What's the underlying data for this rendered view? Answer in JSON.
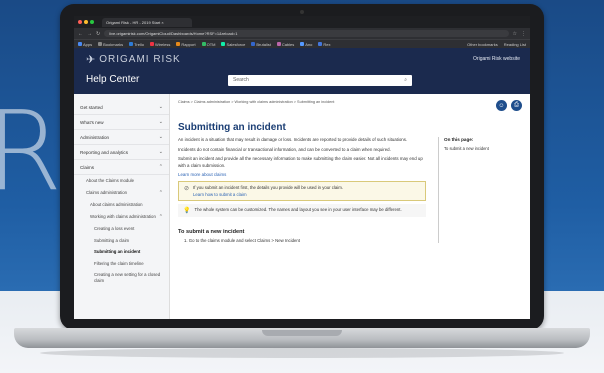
{
  "background": {
    "letter": "R",
    "brand_color": "#1f5ea4"
  },
  "browser": {
    "tab_title": "Origami Risk - HR - 2019 Start  ×",
    "url": "live.origamirisk.com/OrigamiCloud/Dashboards/Home?RSF=1&reload=1",
    "bookmarks": [
      "Apps",
      "Bookmarks",
      "Trello",
      "Wireless",
      "Rapport",
      "OTM",
      "Salesforce",
      "Brutalist",
      "Cables",
      "Ano",
      "Rex"
    ],
    "bookmarks_right": [
      "Other bookmarks",
      "Reading List"
    ]
  },
  "header": {
    "logo_text": "ORIGAMI RISK",
    "title": "Help Center",
    "site_link": "Origami Risk website",
    "search_placeholder": "Search",
    "search_icon": "search-icon"
  },
  "sidebar": {
    "items": [
      {
        "label": "Get started",
        "chevron": "⌄"
      },
      {
        "label": "What's new",
        "chevron": "⌄"
      },
      {
        "label": "Administration",
        "chevron": "⌄"
      },
      {
        "label": "Reporting and analytics",
        "chevron": "⌄"
      },
      {
        "label": "Claims",
        "chevron": "⌃"
      }
    ],
    "claims_sub": [
      "About the Claims module",
      "Claims administration"
    ],
    "claims_admin_sub": [
      "About claims administration",
      "Working with claims administration"
    ],
    "working_sub": [
      "Creating a loss event",
      "Submitting a claim",
      "Submitting an incident",
      "Filtering the claim timeline",
      "Creating a new setting for a closed claim"
    ]
  },
  "main": {
    "breadcrumb": "Claims > Claims administration > Working with claims administration > Submitting an incident",
    "title": "Submitting an incident",
    "para1": "An incident is a situation that may result in damage or loss. Incidents are reported to provide details of such situations.",
    "para2": "Incidents do not contain financial or transactional information, and can be converted to a claim when required.",
    "para3": "Submit an incident and provide all the necessary information to make submitting the claim easier. Not all incidents may end up with a claim submission.",
    "learn_more": "Learn more about claims",
    "note_text": "If you submit an incident first, the details you provide will be used in your claim.",
    "note_link": "Learn how to submit a claim",
    "tip_text": "The whole system can be customized. The names and layout you see in your user interface may be different.",
    "section_title": "To submit a new incident",
    "step1": "1.   Go to the claims module and select Claims > New Incident",
    "toc_title": "On this page:",
    "toc_items": [
      "To submit a new incident"
    ]
  }
}
